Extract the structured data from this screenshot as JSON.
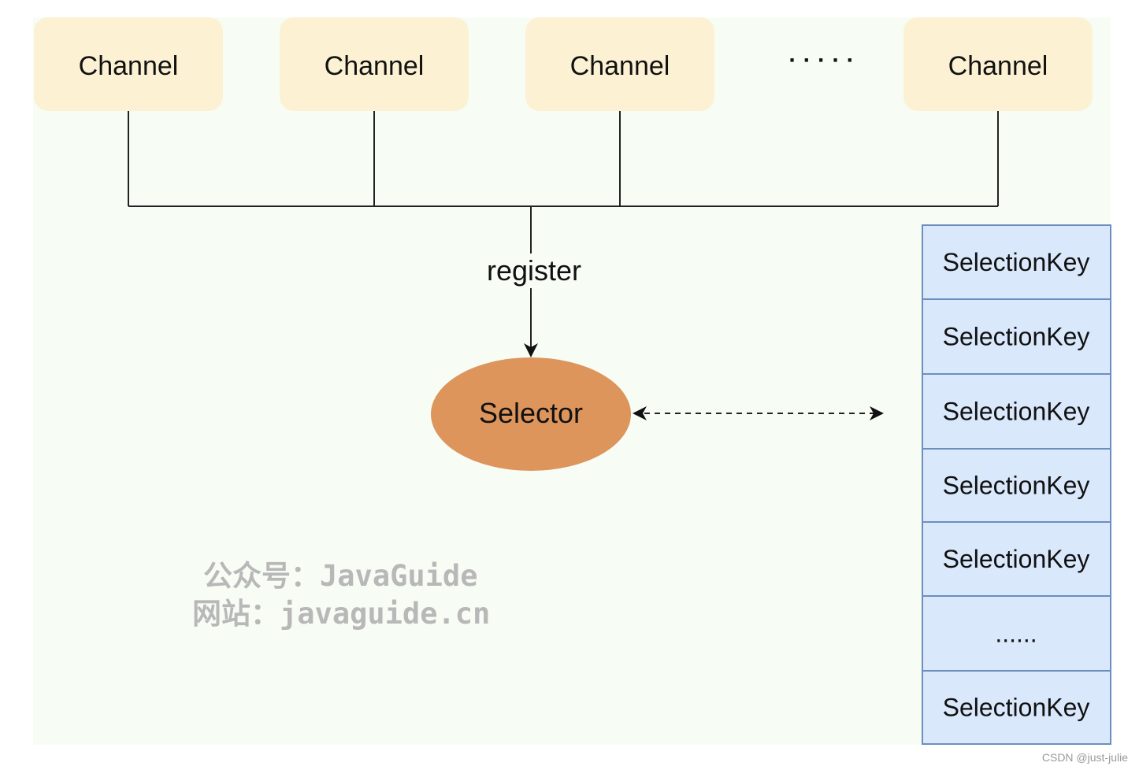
{
  "channels": [
    "Channel",
    "Channel",
    "Channel",
    "Channel"
  ],
  "ellipsis_top": "· · · · ·",
  "register_label": "register",
  "selector_label": "Selector",
  "selection_keys": [
    "SelectionKey",
    "SelectionKey",
    "SelectionKey",
    "SelectionKey",
    "SelectionKey",
    "......",
    "SelectionKey"
  ],
  "watermark": {
    "line1": "公众号：JavaGuide",
    "line2": "网站：javaguide.cn"
  },
  "credit": "CSDN @just-julie",
  "colors": {
    "background": "#f7fdf5",
    "channel_fill": "#fcf1d2",
    "selector_fill": "#dd955c",
    "key_fill": "#dae8fc",
    "key_stroke": "#6c8ebf"
  }
}
